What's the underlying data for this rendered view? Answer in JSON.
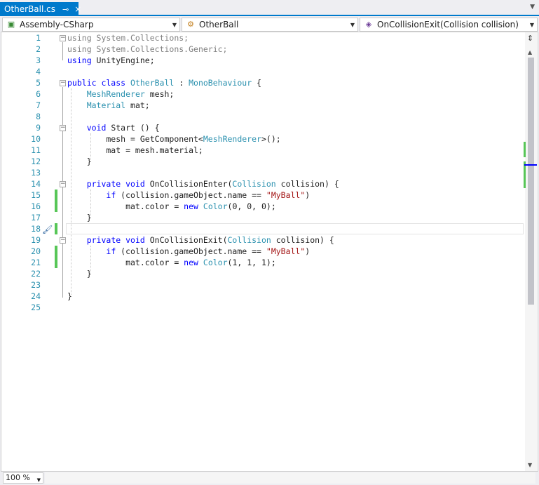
{
  "tab": {
    "title": "OtherBall.cs",
    "pin": "⊸",
    "close": "×"
  },
  "navbar": {
    "project": "Assembly-CSharp",
    "class": "OtherBall",
    "member": "OnCollisionExit(Collision collision)"
  },
  "editor": {
    "line_numbers": [
      "1",
      "2",
      "3",
      "4",
      "5",
      "6",
      "7",
      "8",
      "9",
      "10",
      "11",
      "12",
      "13",
      "14",
      "15",
      "16",
      "17",
      "18",
      "19",
      "20",
      "21",
      "22",
      "23",
      "24",
      "25"
    ],
    "lines": [
      [
        {
          "t": "using",
          "c": "gr"
        },
        {
          "t": " System.Collections;",
          "c": "gr"
        }
      ],
      [
        {
          "t": "using",
          "c": "gr"
        },
        {
          "t": " System.Collections.Generic;",
          "c": "gr"
        }
      ],
      [
        {
          "t": "using",
          "c": "kw"
        },
        {
          "t": " UnityEngine;",
          "c": ""
        }
      ],
      [],
      [
        {
          "t": "public class ",
          "c": "kw"
        },
        {
          "t": "OtherBall",
          "c": "ty"
        },
        {
          "t": " : ",
          "c": ""
        },
        {
          "t": "MonoBehaviour",
          "c": "ty"
        },
        {
          "t": " {",
          "c": ""
        }
      ],
      [
        {
          "t": "    ",
          "c": ""
        },
        {
          "t": "MeshRenderer",
          "c": "ty"
        },
        {
          "t": " mesh;",
          "c": ""
        }
      ],
      [
        {
          "t": "    ",
          "c": ""
        },
        {
          "t": "Material",
          "c": "ty"
        },
        {
          "t": " mat;",
          "c": ""
        }
      ],
      [],
      [
        {
          "t": "    ",
          "c": ""
        },
        {
          "t": "void",
          "c": "kw"
        },
        {
          "t": " Start () {",
          "c": ""
        }
      ],
      [
        {
          "t": "        mesh = GetComponent<",
          "c": ""
        },
        {
          "t": "MeshRenderer",
          "c": "ty"
        },
        {
          "t": ">();",
          "c": ""
        }
      ],
      [
        {
          "t": "        mat = mesh.material;",
          "c": ""
        }
      ],
      [
        {
          "t": "    }",
          "c": ""
        }
      ],
      [],
      [
        {
          "t": "    ",
          "c": ""
        },
        {
          "t": "private void",
          "c": "kw"
        },
        {
          "t": " OnCollisionEnter(",
          "c": ""
        },
        {
          "t": "Collision",
          "c": "ty"
        },
        {
          "t": " collision) {",
          "c": ""
        }
      ],
      [
        {
          "t": "        ",
          "c": ""
        },
        {
          "t": "if",
          "c": "kw"
        },
        {
          "t": " (collision.gameObject.name == ",
          "c": ""
        },
        {
          "t": "\"MyBall\"",
          "c": "st"
        },
        {
          "t": ")",
          "c": ""
        }
      ],
      [
        {
          "t": "            mat.color = ",
          "c": ""
        },
        {
          "t": "new",
          "c": "kw"
        },
        {
          "t": " ",
          "c": ""
        },
        {
          "t": "Color",
          "c": "ty"
        },
        {
          "t": "(0, 0, 0);",
          "c": ""
        }
      ],
      [
        {
          "t": "    }",
          "c": ""
        }
      ],
      [],
      [
        {
          "t": "    ",
          "c": ""
        },
        {
          "t": "private void",
          "c": "kw"
        },
        {
          "t": " OnCollisionExit(",
          "c": ""
        },
        {
          "t": "Collision",
          "c": "ty"
        },
        {
          "t": " collision) {",
          "c": ""
        }
      ],
      [
        {
          "t": "        ",
          "c": ""
        },
        {
          "t": "if",
          "c": "kw"
        },
        {
          "t": " (collision.gameObject.name == ",
          "c": ""
        },
        {
          "t": "\"MyBall\"",
          "c": "st"
        },
        {
          "t": ")",
          "c": ""
        }
      ],
      [
        {
          "t": "            mat.color = ",
          "c": ""
        },
        {
          "t": "new",
          "c": "kw"
        },
        {
          "t": " ",
          "c": ""
        },
        {
          "t": "Color",
          "c": "ty"
        },
        {
          "t": "(1, 1, 1);",
          "c": ""
        }
      ],
      [
        {
          "t": "    }",
          "c": ""
        }
      ],
      [],
      [
        {
          "t": "}",
          "c": ""
        }
      ],
      []
    ]
  },
  "status": {
    "zoom": "100 %"
  },
  "colors": {
    "accent": "#007acc",
    "keyword": "#0000ff",
    "type": "#2b91af",
    "string": "#a31515",
    "changed": "#57c657"
  }
}
